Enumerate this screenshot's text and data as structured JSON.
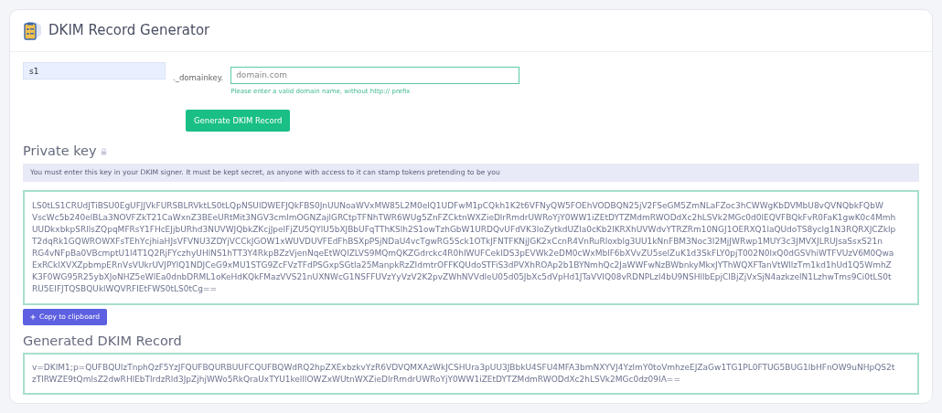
{
  "header": {
    "title": "DKIM Record Generator"
  },
  "form": {
    "selector": {
      "value": "s1"
    },
    "separator": "._domainkey.",
    "domain": {
      "placeholder": "domain.com"
    },
    "help": "Please enter a valid domain name, without http:// prefix",
    "generate_button": "Generate DKIM Record"
  },
  "private_key": {
    "heading": "Private key",
    "notice": "You must enter this key in your DKIM signer. It must be kept secret, as anyone with access to it can stamp tokens pretending to be you",
    "lines": [
      "LS0tLS1CRUdJTiBSU0EgUFJJVkFURSBLRVktLS0tLQpNSUlDWEFJQkFBS0JnUUNoaWVxMW85L2M0elQ1UDFwM1pCQkh1K2t6VFNyQW5FOEhVODBQN25jV2FSeGM5ZmNLaFZoc3hCWWgKbDVMbU8vQVNQbkFQbW",
      "VscWc5b240elBLa3NOVFZkT21CaWxnZ3BEeURtMit3NGV3cmlmOGNZajlGRCtpTFNhTWR6WUg5ZnFZCktnWXZieDlrRmdrUWRoYjY0WW1iZEtDYTZMdmRWODdXc2hLSVk2MGc0d0lEQVFBQkFvR0FaK1gwK0c4Mmh",
      "UUDkxbkpSRllsZQpqMFRsY1FHcEJjbURhd3NUVWJQbkZKcjJpelFjZU5QYlU5bXJBbUFqTThKSlh2S1owTzhGbW1URDQvUFdVK3loZytkdUZla0cKb2lKRXhUVWdvYTRZRm10NGJ1OERXQ1laQUdoTS8yclg1N3RQRXJCZklp",
      "T2dqRk1GQWROWXFsTEhYcjhiaHJsVFVNU3ZDYjVCCkJGOW1xWUVDUVFEdFhBSXpPSjNDaU4vcTgwRG5Sck1OTkJFNTFKNjJGK2xCcnR4VnRuRloxblg3UU1kNnFBM3Noc3I2MjJWRwp1MUY3c3JMVXJLRUJsaSsxS21n",
      "RG4vNFpBa0VBcmptU1l4T1Q2RjFYczhyUHlNS1hTT3Y4RkpBZzVjenNqeEtWQlZLVS9MQmQKZGdrckc4R0hIWUFCeklDS3pEVWk2eDM0cWxMblF6bXVvZU5selZuK1d3SkFLY0pjT002N0lxQ0dGSVhiWTFVUzV6M0Qwa",
      "ExRCklXVXZpbmpERnVsVUkrUVJPYlQ1NDJCeG9xMU1STG9ZcFVzTFdPSGxpSGtla25ManpkRzZIdmtrOFFKQUdoSTFiS3dPVXhROAp2b1BYNmhQc2JaWWFwNzBWbnkyMkxJYThWQXFTanVtWllzTm1kd1hUd1Q5WmhZ",
      "K3F0WG95R25ybXJoNHZ5eWlEa0dnbDRML1oKeHdKQkFMazVVS21nUXNWcG1NSFFUVzYyVzV2K2pvZWhNVVdleU05d05JbXc5dVpHd1JTaVVIQ08vRDNPLzl4bU9NSHllbEpjClBjZjVxSjN4azkzelN1LzhwTms9Ci0tLS0t",
      "RU5EIFJTQSBQUklWQVRFIEtFWS0tLS0tCg=="
    ],
    "copy_button": "Copy to clipboard"
  },
  "generated_record": {
    "heading": "Generated DKIM Record",
    "lines": [
      "v=DKIM1;p=QUFBQUIzTnphQzF5YzJFQUFBQURBUUFCQUFBQWdRQ2hpZXExbzkvYzR6VDVQMXAzWkJCSHUra3pUU3JBbkU4SFU4MFA3bmNXYVJ4YzlmY0toVmhzeEJZaGw1TG1PL0FTUG5BUG1lbHFnOW9uNHpQS2t",
      "zTlRWZE9tQmlsZ2dwRHlEbTlrdzRld3JpZjhjWWo5RkQraUxTYU1kellIOWZxWUtnWXZieDlrRmdrUWRoYjY0WW1iZEtDYTZMdmRWODdXc2hLSVk2MGc0dz09IA=="
    ]
  }
}
